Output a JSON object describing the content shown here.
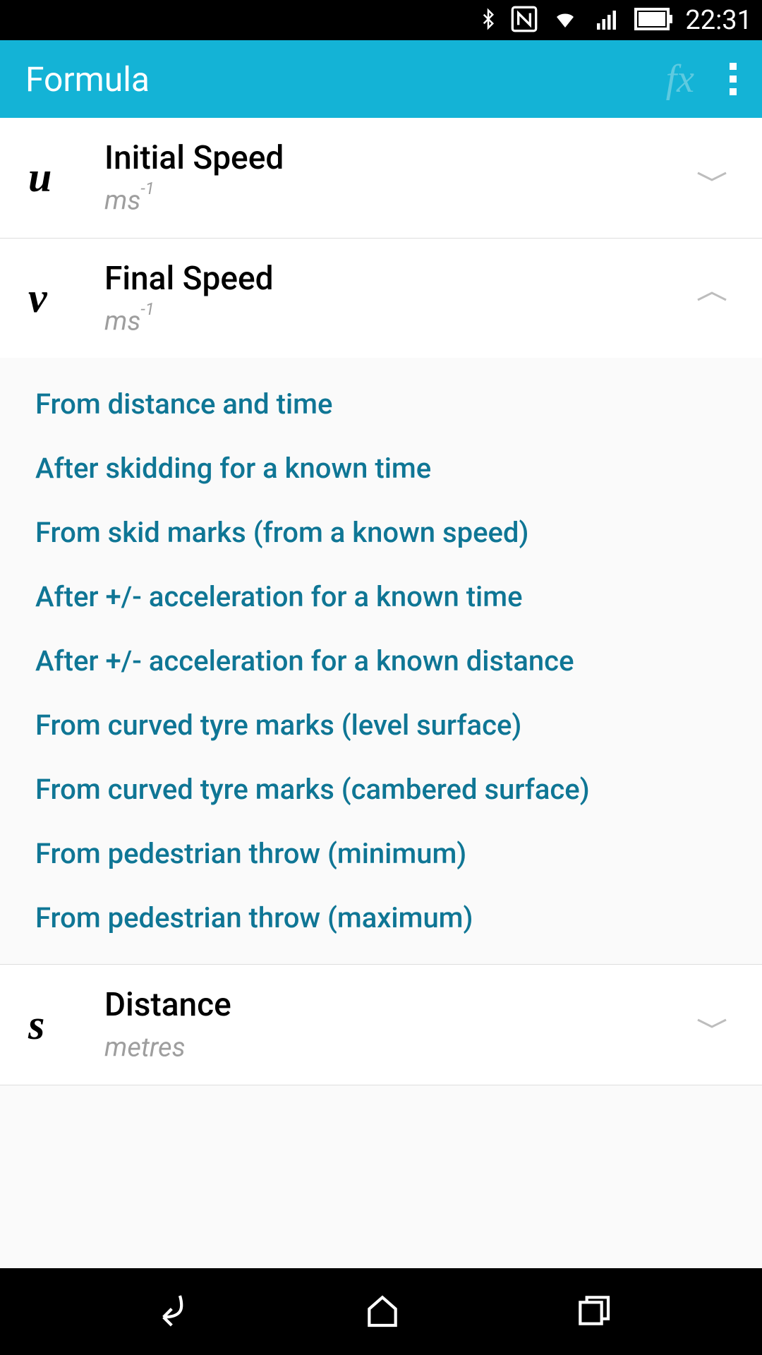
{
  "status": {
    "time": "22:31"
  },
  "header": {
    "title": "Formula"
  },
  "items": [
    {
      "symbol": "u",
      "title": "Initial Speed",
      "unit_base": "ms",
      "unit_exp": "-1",
      "expanded": false
    },
    {
      "symbol": "v",
      "title": "Final Speed",
      "unit_base": "ms",
      "unit_exp": "-1",
      "expanded": true
    },
    {
      "symbol": "s",
      "title": "Distance",
      "unit_base": "metres",
      "unit_exp": "",
      "expanded": false
    }
  ],
  "subitems": [
    "From distance and time",
    "After skidding for a known time",
    "From skid marks (from a known speed)",
    "After +/- acceleration for a known time",
    "After +/- acceleration for a known distance",
    "From curved tyre marks (level surface)",
    "From curved tyre marks (cambered surface)",
    "From pedestrian throw (minimum)",
    "From pedestrian throw (maximum)"
  ]
}
